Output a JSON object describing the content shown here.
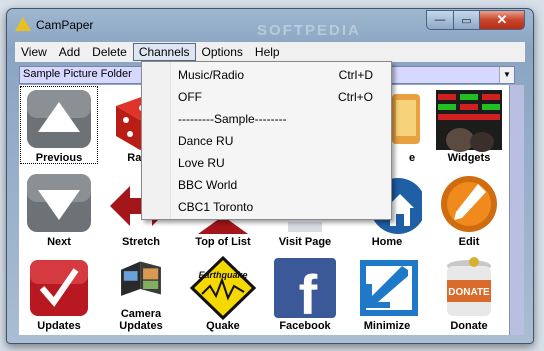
{
  "window": {
    "title": "CamPaper"
  },
  "watermark": "SOFTPEDIA",
  "menubar": [
    {
      "label": "View"
    },
    {
      "label": "Add"
    },
    {
      "label": "Delete"
    },
    {
      "label": "Channels",
      "open": true
    },
    {
      "label": "Options"
    },
    {
      "label": "Help"
    }
  ],
  "folder_select": {
    "value": "Sample Picture Folder"
  },
  "channels_menu": [
    {
      "label": "Music/Radio",
      "shortcut": "Ctrl+D"
    },
    {
      "label": "OFF",
      "shortcut": "Ctrl+O"
    },
    {
      "label": "---------Sample--------",
      "shortcut": ""
    },
    {
      "label": "Dance RU",
      "shortcut": ""
    },
    {
      "label": "Love RU",
      "shortcut": ""
    },
    {
      "label": "BBC World",
      "shortcut": ""
    },
    {
      "label": "CBC1 Toronto",
      "shortcut": ""
    }
  ],
  "tiles": [
    {
      "label": "Previous",
      "icon": "up-arrow-icon"
    },
    {
      "label": "Rand",
      "icon": "dice-icon"
    },
    {
      "label": "",
      "icon": "hidden-tile"
    },
    {
      "label": "",
      "icon": "hidden-tile"
    },
    {
      "label": "e",
      "icon": "music-icon"
    },
    {
      "label": "Widgets",
      "icon": "stock-ticker-icon"
    },
    {
      "label": "Next",
      "icon": "down-arrow-icon"
    },
    {
      "label": "Stretch",
      "icon": "stretch-arrows-icon"
    },
    {
      "label": "Top of List",
      "icon": "top-list-icon"
    },
    {
      "label": "Visit Page",
      "icon": "visit-page-icon"
    },
    {
      "label": "Home",
      "icon": "home-icon"
    },
    {
      "label": "Edit",
      "icon": "pencil-icon"
    },
    {
      "label": "Updates",
      "icon": "checkmark-icon"
    },
    {
      "label": "Camera Updates",
      "icon": "photo-album-icon"
    },
    {
      "label": "Quake",
      "icon": "earthquake-sign-icon",
      "sign_text": "Earthquake"
    },
    {
      "label": "Facebook",
      "icon": "facebook-icon",
      "glyph": "f"
    },
    {
      "label": "Minimize",
      "icon": "minimize-arrow-icon"
    },
    {
      "label": "Donate",
      "icon": "donate-jar-icon",
      "jar_text": "DONATE"
    }
  ]
}
